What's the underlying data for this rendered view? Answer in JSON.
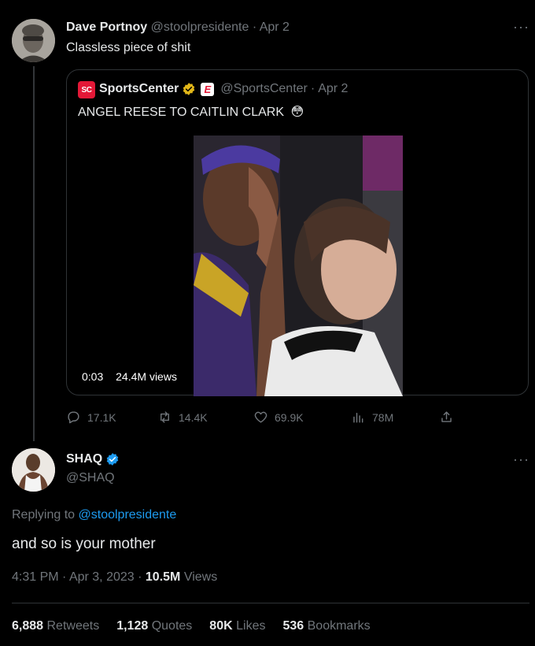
{
  "original_tweet": {
    "name": "Dave Portnoy",
    "handle": "@stoolpresidente",
    "separator": "·",
    "date": "Apr 2",
    "text": "Classless piece of shit"
  },
  "quoted_tweet": {
    "name": "SportsCenter",
    "espn_letter": "E",
    "logo_text": "SC",
    "handle": "@SportsCenter",
    "separator": "·",
    "date": "Apr 2",
    "text": "ANGEL REESE TO CAITLIN CLARK",
    "emoji": "😳",
    "video": {
      "time": "0:03",
      "views": "24.4M views"
    }
  },
  "actions": {
    "replies": "17.1K",
    "retweets": "14.4K",
    "likes": "69.9K",
    "views": "78M"
  },
  "reply_tweet": {
    "name": "SHAQ",
    "handle": "@SHAQ",
    "replying_prefix": "Replying to",
    "replying_to": "@stoolpresidente",
    "text": "and so is your mother",
    "time": "4:31 PM",
    "date_sep": "·",
    "date": "Apr 3, 2023",
    "views_sep": "·",
    "views_count": "10.5M",
    "views_label": "Views"
  },
  "stats": {
    "retweets_count": "6,888",
    "retweets_label": "Retweets",
    "quotes_count": "1,128",
    "quotes_label": "Quotes",
    "likes_count": "80K",
    "likes_label": "Likes",
    "bookmarks_count": "536",
    "bookmarks_label": "Bookmarks"
  },
  "more_glyph": "···",
  "colors": {
    "background": "#000000",
    "text": "#e7e9ea",
    "muted": "#71767b",
    "link": "#1d9bf0",
    "verified_gold": "#e2b719",
    "verified_blue": "#1d9bf0",
    "espn_red": "#e31837",
    "divider": "#2f3336"
  }
}
